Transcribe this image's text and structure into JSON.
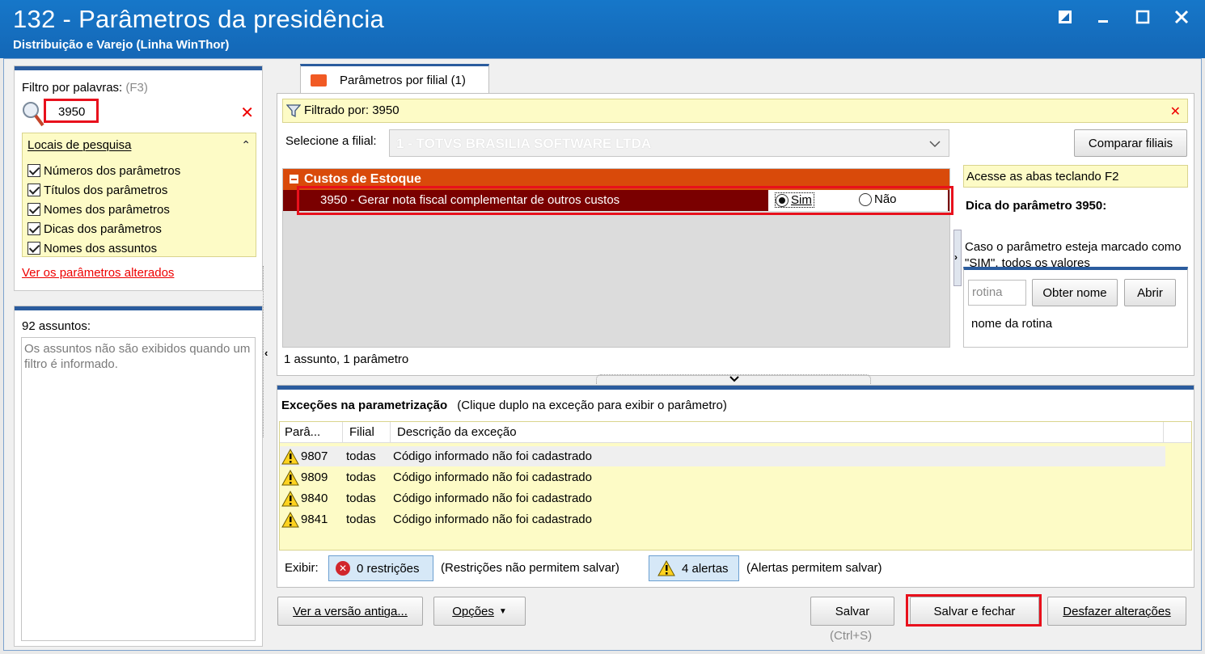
{
  "window": {
    "title": "132 - Parâmetros da presidência",
    "subtitle": "Distribuição e Varejo (Linha WinThor)"
  },
  "filter": {
    "label": "Filtro por palavras:",
    "shortcut": "(F3)",
    "value": "3950",
    "locais_title": "Locais de pesquisa",
    "options": [
      "Números dos parâmetros",
      "Títulos dos parâmetros",
      "Nomes dos parâmetros",
      "Dicas dos parâmetros",
      "Nomes dos assuntos"
    ],
    "altered_link": "Ver os parâmetros alterados"
  },
  "assuntos": {
    "count_label": "92 assuntos:",
    "message": "Os assuntos não são exibidos quando um filtro é informado."
  },
  "tab": {
    "label": "Parâmetros por filial",
    "count": "(1)"
  },
  "filtered": {
    "text": "Filtrado por: 3950"
  },
  "filial": {
    "label": "Selecione a filial:",
    "value": "1 - TOTVS BRASILIA SOFTWARE LTDA",
    "compare_button": "Comparar filiais"
  },
  "group": {
    "name": "Custos de Estoque",
    "param_label": "3950 - Gerar nota fiscal complementar de outros custos",
    "option_yes": "Sim",
    "option_no": "Não",
    "selected": "Sim"
  },
  "summary": "1 assunto, 1 parâmetro",
  "hint": {
    "tab_tip": "Acesse as abas teclando F2",
    "title": "Dica do parâmetro 3950:",
    "text": "Caso o parâmetro esteja marcado como \"SIM\", todos os valores"
  },
  "rotina": {
    "placeholder": "rotina",
    "obter_button": "Obter nome",
    "abrir_button": "Abrir",
    "nome_label": "nome da rotina"
  },
  "exceptions": {
    "title": "Exceções na parametrização",
    "subtitle": "(Clique duplo na exceção para exibir o parâmetro)",
    "columns": [
      "Parâ...",
      "Filial",
      "Descrição da exceção"
    ],
    "rows": [
      {
        "param": "9807",
        "filial": "todas",
        "desc": "Código informado não foi cadastrado"
      },
      {
        "param": "9809",
        "filial": "todas",
        "desc": "Código informado não foi cadastrado"
      },
      {
        "param": "9840",
        "filial": "todas",
        "desc": "Código informado não foi cadastrado"
      },
      {
        "param": "9841",
        "filial": "todas",
        "desc": "Código informado não foi cadastrado"
      }
    ],
    "exibir_label": "Exibir:",
    "restricoes_button": "0 restrições",
    "restricoes_note": "(Restrições não permitem salvar)",
    "alertas_button": "4 alertas",
    "alertas_note": "(Alertas permitem salvar)"
  },
  "footer": {
    "old_version_button": "Ver a versão antiga...",
    "options_button": "Opções",
    "save_button": "Salvar",
    "save_shortcut": "(Ctrl+S)",
    "save_close_button": "Salvar e fechar",
    "undo_button": "Desfazer alterações"
  },
  "colors": {
    "titlebar": "#1467b6",
    "group_header": "#d94a0a",
    "selected_row": "#7a0000",
    "highlight_yellow": "#fdfbc6",
    "red_box": "#e8101c"
  }
}
